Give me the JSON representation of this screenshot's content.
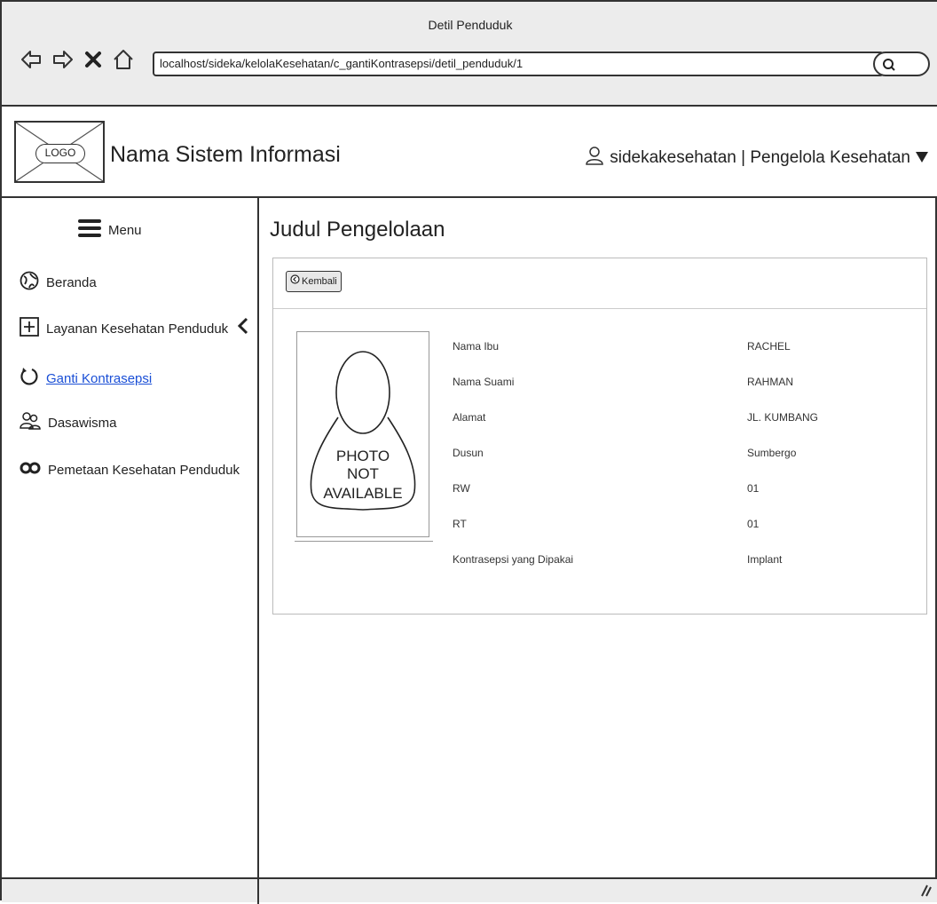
{
  "browser": {
    "window_title": "Detil Penduduk",
    "url": "localhost/sideka/kelolaKesehatan/c_gantiKontrasepsi/detil_penduduk/1"
  },
  "header": {
    "logo_text": "LOGO",
    "system_name": "Nama Sistem Informasi",
    "user_label": "sidekakesehatan | Pengelola Kesehatan"
  },
  "sidebar": {
    "menu_label": "Menu",
    "items": [
      {
        "label": "Beranda",
        "icon": "globe-icon"
      },
      {
        "label": "Layanan Kesehatan Penduduk",
        "icon": "plus-box-icon"
      },
      {
        "label": "Ganti Kontrasepsi",
        "icon": "refresh-icon",
        "active": true
      },
      {
        "label": "Dasawisma",
        "icon": "users-icon"
      },
      {
        "label": "Pemetaan Kesehatan Penduduk",
        "icon": "link-icon"
      }
    ]
  },
  "main": {
    "title": "Judul Pengelolaan",
    "back_button": "Kembali",
    "photo_text": [
      "PHOTO",
      "NOT",
      "AVAILABLE"
    ],
    "details": [
      {
        "key": "Nama Ibu",
        "value": "RACHEL"
      },
      {
        "key": "Nama Suami",
        "value": "RAHMAN"
      },
      {
        "key": "Alamat",
        "value": "JL. KUMBANG"
      },
      {
        "key": "Dusun",
        "value": "Sumbergo"
      },
      {
        "key": "RW",
        "value": "01"
      },
      {
        "key": "RT",
        "value": "01"
      },
      {
        "key": "Kontrasepsi yang Dipakai",
        "value": "Implant"
      }
    ]
  },
  "colors": {
    "link": "#1a4fd6",
    "chrome": "#ececec",
    "border": "#333333"
  }
}
